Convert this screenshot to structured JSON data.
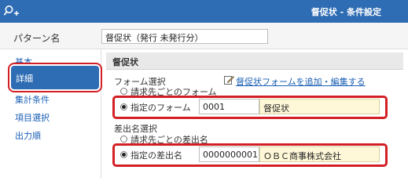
{
  "window": {
    "title": "督促状 - 条件設定",
    "app_icon": "search-plus-icon",
    "accent_color": "#2e6cb4"
  },
  "pattern": {
    "label": "パターン名",
    "value": "督促状（発行 未発行分）"
  },
  "sidebar": {
    "items": [
      {
        "label": "基本"
      },
      {
        "label": "詳細"
      },
      {
        "label": "集計条件"
      },
      {
        "label": "項目選択"
      },
      {
        "label": "出力順"
      }
    ],
    "active": "詳細"
  },
  "section": {
    "title": "督促状"
  },
  "form_select": {
    "label": "フォーム選択",
    "link": "督促状フォームを追加・編集する",
    "link_icon": "edit-icon",
    "option_per_customer": "請求先ごとのフォーム",
    "option_specified": "指定のフォーム",
    "selected": "指定のフォーム",
    "code": "0001",
    "name": "督促状"
  },
  "sender_select": {
    "label": "差出名選択",
    "option_per_customer": "請求先ごとの差出名",
    "option_specified": "指定の差出名",
    "selected": "指定の差出名",
    "code": "0000000001",
    "name": "ＯＢＣ商事株式会社"
  },
  "highlight_color": "#d31f24"
}
